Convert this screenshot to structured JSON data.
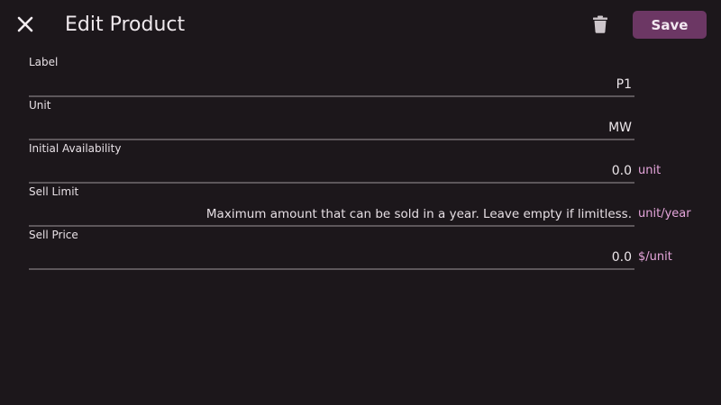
{
  "header": {
    "close_icon": "close-icon",
    "title": "Edit Product",
    "delete_icon": "trash-icon",
    "save_label": "Save"
  },
  "colors": {
    "background": "#1c171b",
    "accent_button": "#6c3764",
    "unit_text": "#e6a6dc",
    "underline": "#5d575b"
  },
  "form": {
    "fields": [
      {
        "label": "Label",
        "value": "P1",
        "unit": ""
      },
      {
        "label": "Unit",
        "value": "MW",
        "unit": ""
      },
      {
        "label": "Initial Availability",
        "value": "0.0",
        "unit": "unit"
      },
      {
        "label": "Sell Limit",
        "placeholder": "Maximum amount that can be sold in a year. Leave empty if limitless.",
        "unit": "unit/year"
      },
      {
        "label": "Sell Price",
        "value": "0.0",
        "unit": "$/unit"
      }
    ]
  }
}
